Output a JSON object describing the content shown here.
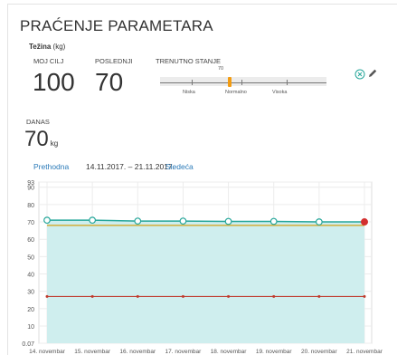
{
  "header": {
    "title": "PRAĆENJE PARAMETARA"
  },
  "weight": {
    "label_bold": "Težina",
    "label_unit": "(kg)",
    "goal_label": "MOJ CILJ",
    "goal_value": "100",
    "last_label": "POSLEDNJI",
    "last_value": "70",
    "state_label": "TRENUTNO STANJE",
    "state_marker_value": "70",
    "scale_low": "Niska",
    "scale_normal": "Normalno",
    "scale_high": "Visoka"
  },
  "today": {
    "label": "DANAS",
    "value": "70",
    "unit": "kg"
  },
  "nav": {
    "prev": "Prethodna",
    "range": "14.11.2017. – 21.11.2017.",
    "next": "Sledeća"
  },
  "icons": {
    "clear": "circle-x-icon",
    "edit": "pencil-icon"
  },
  "colors": {
    "accent": "#2a7ab8",
    "marker": "#f39c12",
    "teal": "#26a69a",
    "goal_line": "#c0392b",
    "area": "#cfeeee"
  },
  "chart_data": {
    "type": "area",
    "categories": [
      "14. novembar",
      "15. novembar",
      "16. novembar",
      "17. novembar",
      "18. novembar",
      "19. novembar",
      "20. novembar",
      "21. novembar"
    ],
    "y_ticks": [
      "93",
      "90",
      "80",
      "70",
      "60",
      "50",
      "40",
      "30",
      "20",
      "10",
      "0.07"
    ],
    "ylim": [
      0.07,
      93
    ],
    "grid": true,
    "series": [
      {
        "values": [
          71,
          71,
          70.5,
          70.5,
          70.3,
          70.3,
          70,
          70
        ],
        "color": "#26a69a"
      },
      {
        "values": [
          68,
          68,
          68,
          68,
          68,
          68,
          68,
          68
        ],
        "color": "#d4a017"
      },
      {
        "values": [
          27,
          27,
          27,
          27,
          27,
          27,
          27,
          27
        ],
        "color": "#c0392b"
      }
    ]
  }
}
